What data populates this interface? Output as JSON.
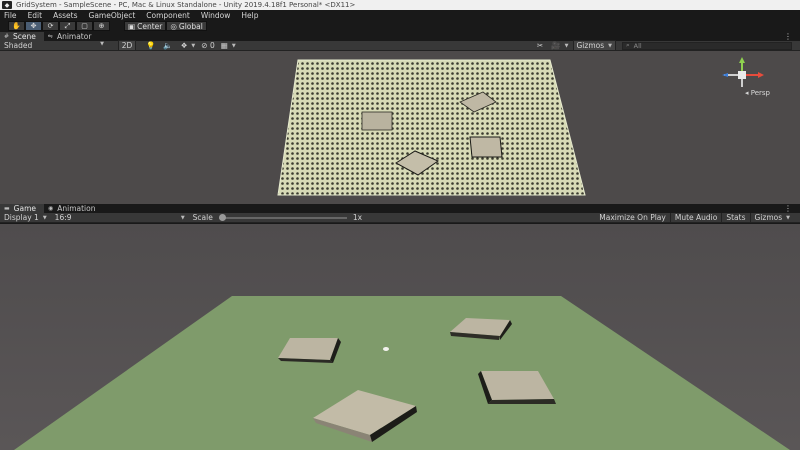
{
  "window": {
    "title": "GridSystem - SampleScene - PC, Mac & Linux Standalone - Unity 2019.4.18f1 Personal* <DX11>"
  },
  "menu": [
    "File",
    "Edit",
    "Assets",
    "GameObject",
    "Component",
    "Window",
    "Help"
  ],
  "toolbar": {
    "tools": [
      "hand-tool-icon",
      "move-tool-icon",
      "rotate-tool-icon",
      "scale-tool-icon",
      "rect-tool-icon",
      "transform-tool-icon"
    ],
    "pivot_label": "Center",
    "rotation_label": "Global"
  },
  "scene_panel": {
    "tabs": [
      {
        "label": "Scene",
        "icon": "scene-icon"
      },
      {
        "label": "Animator",
        "icon": "animator-icon"
      }
    ],
    "shading_mode": "Shaded",
    "mode_2d": "2D",
    "hidden_count": "0",
    "gizmos_label": "Gizmos",
    "search_placeholder": "All",
    "projection_label": "Persp"
  },
  "game_panel": {
    "tabs": [
      {
        "label": "Game",
        "icon": "game-icon"
      },
      {
        "label": "Animation",
        "icon": "animation-icon"
      }
    ],
    "display": "Display 1",
    "aspect": "16:9",
    "scale_label": "Scale",
    "scale_value": "1x",
    "maximize_label": "Maximize On Play",
    "mute_label": "Mute Audio",
    "stats_label": "Stats",
    "gizmos_label": "Gizmos"
  },
  "colors": {
    "editor_dark": "#191919",
    "panel_bar": "#383838",
    "grid_plane": "#d8dcb8",
    "ground": "#7f9b6b",
    "boxes": "#bfb8a4"
  }
}
